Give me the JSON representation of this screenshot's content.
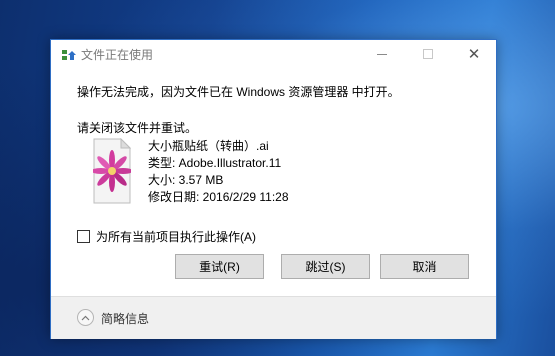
{
  "dialog": {
    "title": "文件正在使用",
    "message": "操作无法完成，因为文件已在 Windows 资源管理器 中打开。",
    "instruction": "请关闭该文件并重试。"
  },
  "file": {
    "name": "大小瓶贴纸（转曲）.ai",
    "type": "类型: Adobe.Illustrator.11",
    "size": "大小: 3.57 MB",
    "modified": "修改日期: 2016/2/29 11:28"
  },
  "checkbox": {
    "label": "为所有当前项目执行此操作(A)",
    "checked": false
  },
  "buttons": {
    "retry": "重试(R)",
    "skip": "跳过(S)",
    "cancel": "取消"
  },
  "footer": {
    "details_label": "简略信息"
  },
  "window_controls": {
    "close": "✕"
  },
  "icons": {
    "title": "file-transfer-icon",
    "expand": "chevron-up-icon",
    "file": "illustrator-file-thumbnail"
  }
}
